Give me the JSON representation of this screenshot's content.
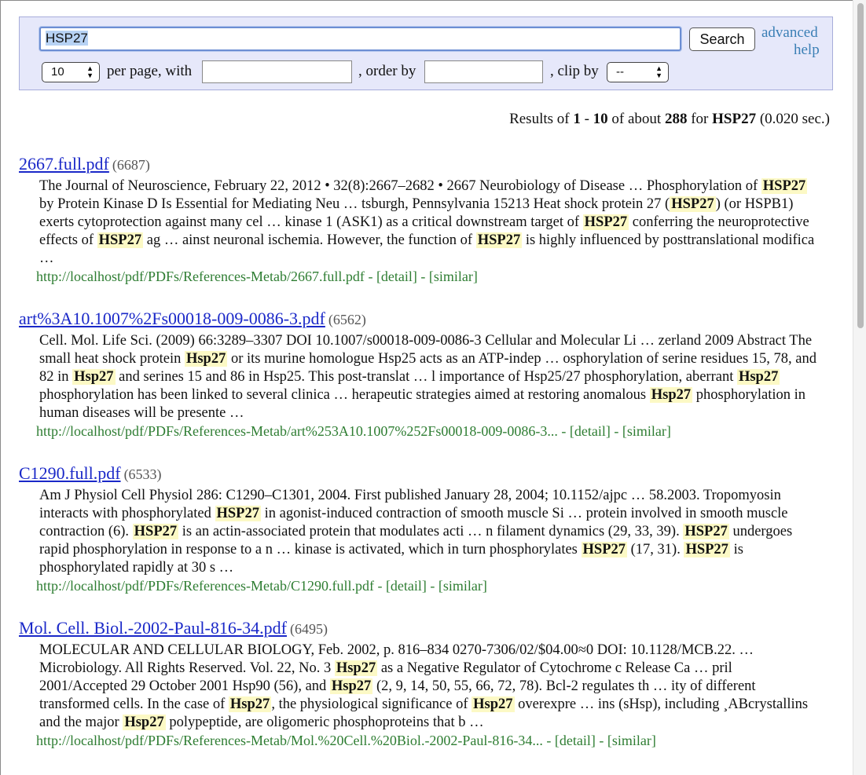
{
  "search": {
    "query": "HSP27",
    "button_label": "Search",
    "advanced_label": "advanced",
    "help_label": "help",
    "per_page_value": "10",
    "per_page_label": "per page, with",
    "order_label": ", order by",
    "clip_label": ", clip by",
    "clip_value": "--"
  },
  "stats": {
    "prefix": "Results of ",
    "start": "1",
    "dash": " - ",
    "end": "10",
    "of_about": " of about ",
    "total": "288",
    "for": " for ",
    "query": "HSP27",
    "time": " (0.020 sec.)"
  },
  "results": [
    {
      "title": "2667.full.pdf",
      "score": "(6687)",
      "snippet": [
        "The Journal of Neuroscience, February 22, 2012 • 32(8):2667–2682 • 2667 Neurobiology of Disease … Phosphorylation of ",
        {
          "hl": "HSP27"
        },
        " by Protein Kinase D Is Essential for Mediating Neu … tsburgh, Pennsylvania 15213 Heat shock protein 27 (",
        {
          "hl": "HSP27"
        },
        ") (or HSPB1) exerts cytoprotection against many cel … kinase 1 (ASK1) as a critical downstream target of ",
        {
          "hl": "HSP27"
        },
        " conferring the neuroprotective effects of ",
        {
          "hl": "HSP27"
        },
        " ag … ainst neuronal ischemia. However, the function of ",
        {
          "hl": "HSP27"
        },
        " is highly influenced by posttranslational modifica …"
      ],
      "url": "http://localhost/pdf/PDFs/References-Metab/2667.full.pdf",
      "detail": "[detail]",
      "similar": "[similar]"
    },
    {
      "title": "art%3A10.1007%2Fs00018-009-0086-3.pdf",
      "score": "(6562)",
      "snippet": [
        "Cell. Mol. Life Sci. (2009) 66:3289–3307 DOI 10.1007/s00018-009-0086-3 Cellular and Molecular Li … zerland 2009 Abstract The small heat shock protein ",
        {
          "hl": "Hsp27"
        },
        " or its murine homologue Hsp25 acts as an ATP-indep … osphorylation of serine residues 15, 78, and 82 in ",
        {
          "hl": "Hsp27"
        },
        " and serines 15 and 86 in Hsp25. This post-translat … l importance of Hsp25/27 phosphorylation, aberrant ",
        {
          "hl": "Hsp27"
        },
        " phosphorylation has been linked to several clinica … herapeutic strategies aimed at restoring anomalous ",
        {
          "hl": "Hsp27"
        },
        " phosphorylation in human diseases will be presente …"
      ],
      "url": "http://localhost/pdf/PDFs/References-Metab/art%253A10.1007%252Fs00018-009-0086-3...",
      "detail": "[detail]",
      "similar": "[similar]"
    },
    {
      "title": "C1290.full.pdf",
      "score": "(6533)",
      "snippet": [
        "Am J Physiol Cell Physiol 286: C1290–C1301, 2004. First published January 28, 2004; 10.1152/ajpc … 58.2003. Tropomyosin interacts with phosphorylated ",
        {
          "hl": "HSP27"
        },
        " in agonist-induced contraction of smooth muscle Si … protein involved in smooth muscle contraction (6). ",
        {
          "hl": "HSP27"
        },
        " is an actin-associated protein that modulates acti … n filament dynamics (29, 33, 39). ",
        {
          "hl": "HSP27"
        },
        " undergoes rapid phosphorylation in response to a n … kinase is activated, which in turn phosphorylates ",
        {
          "hl": "HSP27"
        },
        " (17, 31). ",
        {
          "hl": "HSP27"
        },
        " is phosphorylated rapidly at 30 s …"
      ],
      "url": "http://localhost/pdf/PDFs/References-Metab/C1290.full.pdf",
      "detail": "[detail]",
      "similar": "[similar]"
    },
    {
      "title": "Mol. Cell. Biol.-2002-Paul-816-34.pdf",
      "score": "(6495)",
      "snippet": [
        "MOLECULAR AND CELLULAR BIOLOGY, Feb. 2002, p. 816–834 0270-7306/02/$04.00≈0 DOI: 10.1128/MCB.22. … Microbiology. All Rights Reserved. Vol. 22, No. 3 ",
        {
          "hl": "Hsp27"
        },
        " as a Negative Regulator of Cytochrome c Release Ca … pril 2001/Accepted 29 October 2001 Hsp90 (56), and ",
        {
          "hl": "Hsp27"
        },
        " (2, 9, 14, 50, 55, 66, 72, 78). Bcl-2 regulates th … ity of different transformed cells. In the case of ",
        {
          "hl": "Hsp27"
        },
        ", the physiological significance of ",
        {
          "hl": "Hsp27"
        },
        " overexpre … ins (sHsp), including ¸ABcrystallins and the major ",
        {
          "hl": "Hsp27"
        },
        " polypeptide, are oligomeric phosphoproteins that b …"
      ],
      "url": "http://localhost/pdf/PDFs/References-Metab/Mol.%20Cell.%20Biol.-2002-Paul-816-34...",
      "detail": "[detail]",
      "similar": "[similar]"
    }
  ]
}
